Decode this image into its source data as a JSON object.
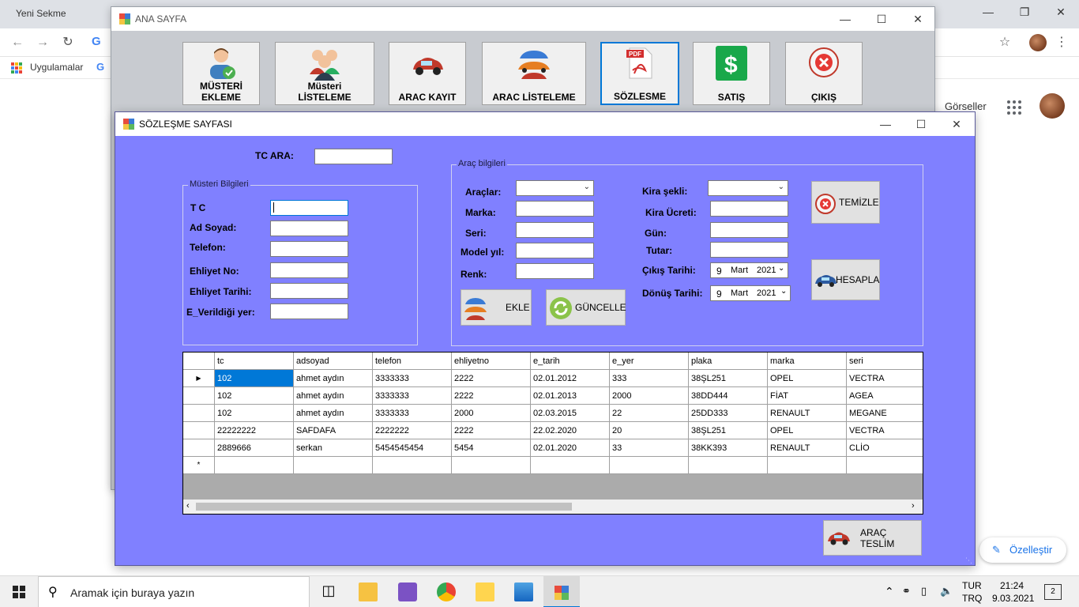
{
  "chrome": {
    "tab_title": "Yeni Sekme",
    "bookmark_apps": "Uygulamalar",
    "bookmark_g": "G",
    "gorseller": "Görseller",
    "customize": "Özelleştir"
  },
  "main_window": {
    "title": "ANA SAYFA",
    "nav": [
      {
        "label": "MÜSTERİ\nEKLEME"
      },
      {
        "label": "Müsteri\nLİSTELEME"
      },
      {
        "label": "ARAC KAYIT"
      },
      {
        "label": "ARAC LİSTELEME"
      },
      {
        "label": "SÖZLESME"
      },
      {
        "label": "SATIŞ"
      },
      {
        "label": "ÇIKIŞ"
      }
    ]
  },
  "contract_window": {
    "title": "SÖZLEŞME SAYFASI",
    "tc_search_label": "TC ARA:",
    "customer_group": "Müsteri Bilgileri",
    "customer_labels": {
      "tc": "T C",
      "ad_soyad": "Ad Soyad:",
      "telefon": "Telefon:",
      "ehliyet_no": "Ehliyet No:",
      "ehliyet_tarihi": "Ehliyet Tarihi:",
      "verildigi_yer": "E_Verildiği yer:"
    },
    "vehicle_group": "Araç bilgileri",
    "vehicle_labels": {
      "araclar": "Araçlar:",
      "marka": "Marka:",
      "seri": "Seri:",
      "model_yil": "Model yıl:",
      "renk": "Renk:",
      "kira_sekli": "Kira şekli:",
      "kira_ucreti": "Kira Ücreti:",
      "gun": "Gün:",
      "tutar": "Tutar:",
      "cikis_tarihi": "Çıkış Tarihi:",
      "donus_tarihi": "Dönüş Tarihi:"
    },
    "cikis_date": {
      "day": "9",
      "month": "Mart",
      "year": "2021"
    },
    "donus_date": {
      "day": "9",
      "month": "Mart",
      "year": "2021"
    },
    "buttons": {
      "temizle": "TEMİZLE",
      "hesapla": "HESAPLA",
      "ekle": "EKLE",
      "guncelle": "GÜNCELLE",
      "arac_teslim": "ARAÇ TESLİM"
    },
    "grid": {
      "columns": [
        "tc",
        "adsoyad",
        "telefon",
        "ehliyetno",
        "e_tarih",
        "e_yer",
        "plaka",
        "marka",
        "seri"
      ],
      "rows": [
        [
          "102",
          "ahmet aydın",
          "3333333",
          "2222",
          "02.01.2012",
          "333",
          "38ŞL251",
          "OPEL",
          "VECTRA"
        ],
        [
          "102",
          "ahmet aydın",
          "3333333",
          "2222",
          "02.01.2013",
          "2000",
          "38DD444",
          "FİAT",
          "AGEA"
        ],
        [
          "102",
          "ahmet aydın",
          "3333333",
          "2000",
          "02.03.2015",
          "22",
          "25DD333",
          "RENAULT",
          "MEGANE"
        ],
        [
          "22222222",
          "SAFDAFA",
          "2222222",
          "2222",
          "22.02.2020",
          "20",
          "38ŞL251",
          "OPEL",
          "VECTRA"
        ],
        [
          "2889666",
          "serkan",
          "5454545454",
          "5454",
          "02.01.2020",
          "33",
          "38KK393",
          "RENAULT",
          "CLİO"
        ]
      ],
      "current_row_marker": "▶",
      "new_row_marker": "*"
    }
  },
  "taskbar": {
    "search_placeholder": "Aramak için buraya yazın",
    "lang_top": "TUR",
    "lang_bottom": "TRQ",
    "time": "21:24",
    "date": "9.03.2021",
    "notif_count": "2"
  },
  "colors": {
    "form_bg": "#8080ff",
    "selection": "#0078d7"
  }
}
